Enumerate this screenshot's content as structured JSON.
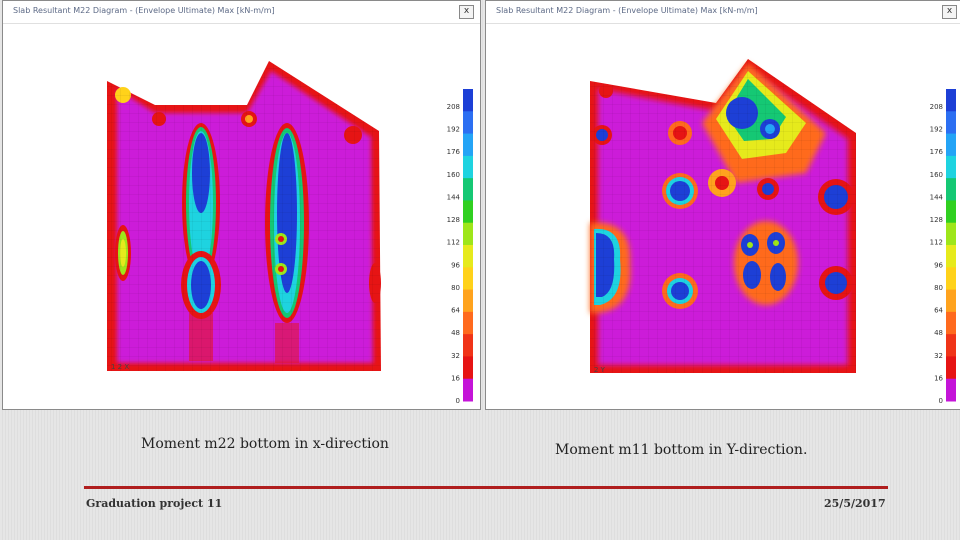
{
  "windows": {
    "left": {
      "title": "Slab Resultant M22 Diagram - (Envelope Ultimate) Max [kN-m/m]",
      "close_label": "x",
      "axis_tag": "1 2 X"
    },
    "right": {
      "title": "Slab Resultant M22 Diagram - (Envelope Ultimate) Max [kN-m/m]",
      "close_label": "x",
      "axis_tag": "2 Y"
    }
  },
  "legend": {
    "values": [
      "208",
      "192",
      "176",
      "160",
      "144",
      "128",
      "112",
      "96",
      "80",
      "64",
      "48",
      "32",
      "16",
      "0"
    ],
    "colors": [
      "#1d3fd6",
      "#2c6ff2",
      "#24a4f6",
      "#1ed3e0",
      "#15c874",
      "#30d020",
      "#9ee61a",
      "#e6ea1c",
      "#ffd21a",
      "#ffa31e",
      "#ff6a1e",
      "#f03418",
      "#e61414",
      "#c414d8"
    ]
  },
  "captions": {
    "left": "Moment m22  bottom  in x-direction",
    "right": "Moment m11  bottom  in Y-direction."
  },
  "footer": {
    "left": "Graduation project 11",
    "right": "25/5/2017"
  },
  "colors": {
    "slab_base": "#cc1fd9",
    "divider": "#b01e1e"
  }
}
